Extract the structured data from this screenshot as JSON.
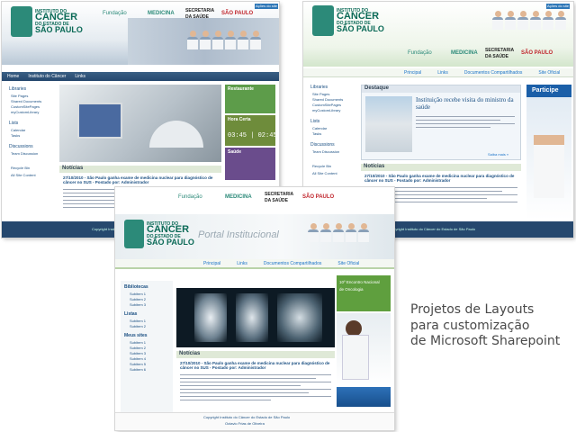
{
  "caption": {
    "lines": [
      "Projetos de Layouts",
      "para customização",
      "de Microsoft Sharepoint"
    ]
  },
  "logo": {
    "lines": [
      "INSTITUTO DO",
      "CANCER",
      "DO ESTADO DE",
      "SÃO PAULO"
    ]
  },
  "brands": {
    "fundacao": "Fundação",
    "medicina": "MEDICINA",
    "secretaria": "SECRETARIA",
    "saude": "DA SAÚDE",
    "sao_paulo": "SÃO PAULO"
  },
  "top_link": "Ações do site",
  "layout1": {
    "nav": [
      "Home",
      "Instituto do Câncer",
      "Links"
    ],
    "sidebar": {
      "lists_title": "Libraries",
      "lists": [
        "Site Pages",
        "Shared Documents",
        "CustomSitePages",
        "myCustomLibrary"
      ],
      "lists2_title": "Lists",
      "lists2": [
        "Calendar",
        "Tasks"
      ],
      "disc_title": "Discussions",
      "disc": [
        "Team Discussion"
      ],
      "bin": "Recycle Bin",
      "content": "All Site Content"
    },
    "widgets": [
      "Restaurante",
      "Hora Certa",
      "Saúde"
    ],
    "clock": "03:45 | 02:45",
    "news_title": "Notícias",
    "news_headline": "27/10/2010 - São Paulo ganha exame de medicina nuclear para diagnóstico de câncer no SUS - Postado por: Administrador",
    "footer": "Copyright Instituto do Câncer do Estado de São Paulo"
  },
  "layout2": {
    "nav": [
      "Principal",
      "Links",
      "Documentos Compartilhados",
      "Site Oficial"
    ],
    "highlight_title": "Destaque",
    "highlight_text": "Instituição recebe visita do ministro da saúde",
    "more": "Saiba mais »",
    "participe": "Participe",
    "news_title": "Notícias",
    "news_headline": "27/10/2010 - São Paulo ganha exame de medicina nuclear para diagnóstico de câncer no SUS - Postado por: Administrador",
    "footer": "Copyright Instituto do Câncer do Estado de São Paulo"
  },
  "layout3": {
    "portal": "Portal Institucional",
    "nav": [
      "Principal",
      "Links",
      "Documentos Compartilhados",
      "Site Oficial"
    ],
    "sidebar": {
      "bib_title": "Bibliotecas",
      "bib": [
        "Subitem 1",
        "Subitem 2",
        "Subitem 3"
      ],
      "listas_title": "Listas",
      "listas": [
        "Subitem 1",
        "Subitem 2"
      ],
      "meus_title": "Meus sites",
      "meus": [
        "Subitem 1",
        "Subitem 2",
        "Subitem 3",
        "Subitem 4",
        "Subitem 5",
        "Subitem 6"
      ]
    },
    "event": [
      "10º Encontro Nacional",
      "de Oncologia"
    ],
    "news_title": "Notícias",
    "news_headline": "27/10/2010 - São Paulo ganha exame de medicina nuclear para diagnóstico de câncer no SUS - Postado por: Administrador",
    "footer": [
      "Copyright Instituto do Câncer do Estado de São Paulo",
      "Octavio Frias de Oliveira"
    ]
  },
  "colors": {
    "brand_green": "#2c8a79",
    "nav_blue": "#1a73c9",
    "header_dark": "#26486e"
  }
}
